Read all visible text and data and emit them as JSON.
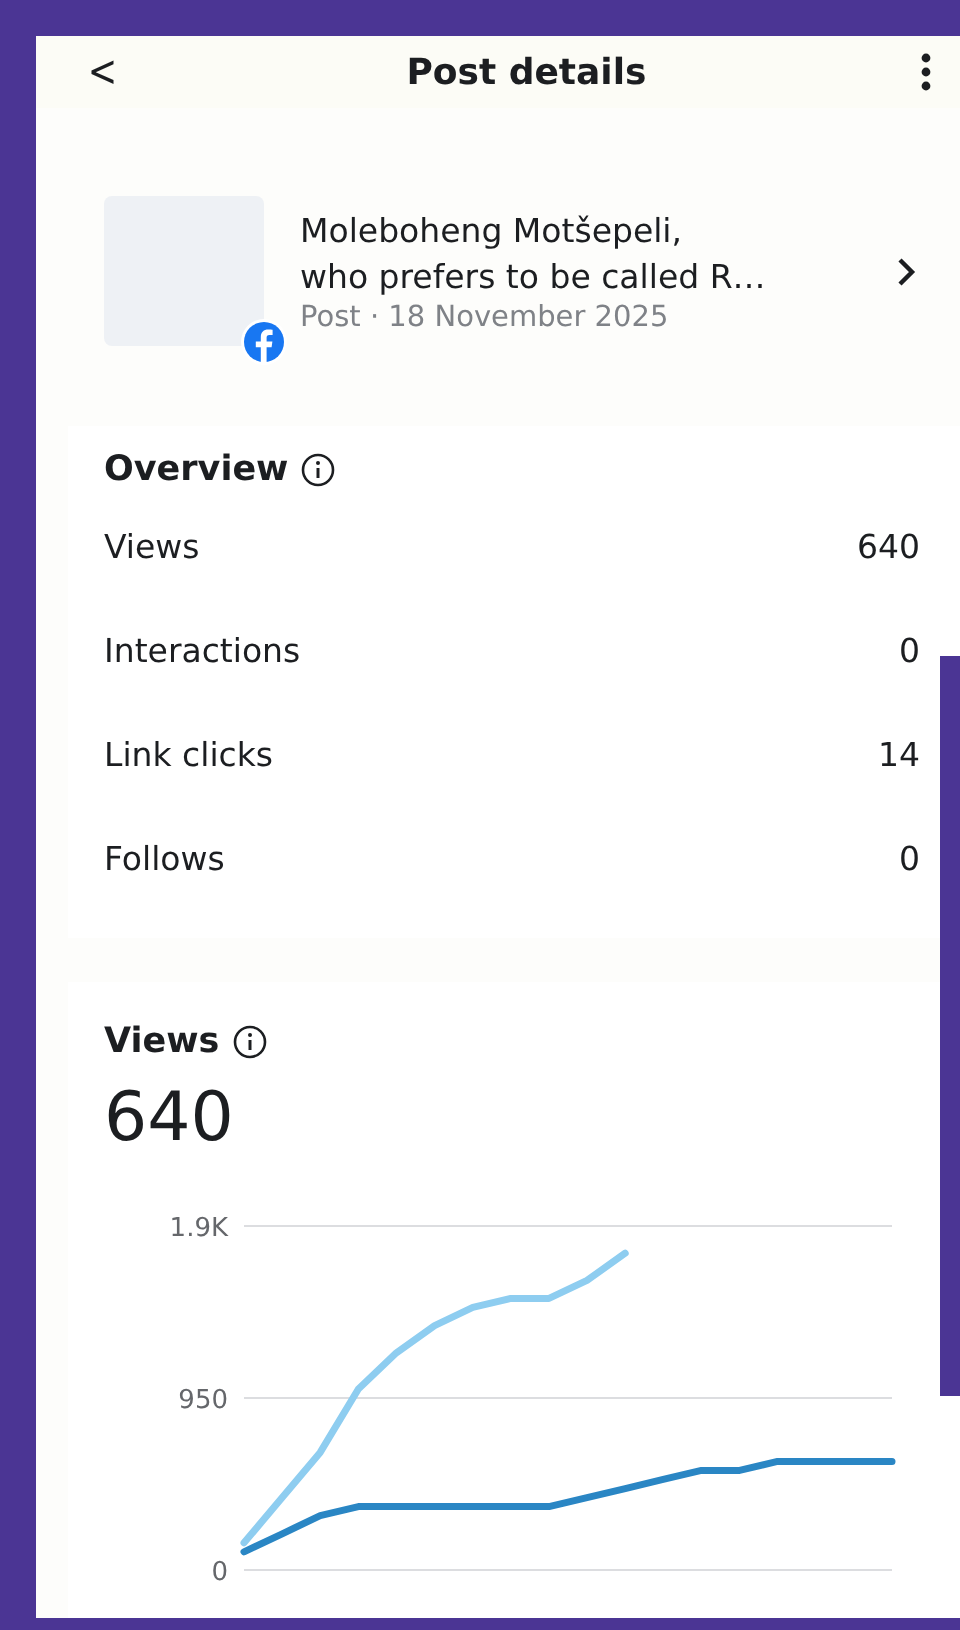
{
  "header": {
    "back": "<",
    "title": "Post details"
  },
  "post": {
    "title": "Moleboheng Motšepeli,\nwho prefers to be called R…",
    "meta": "Post · 18 November 2025"
  },
  "overview": {
    "title": "Overview",
    "rows": [
      {
        "label": "Views",
        "value": "640"
      },
      {
        "label": "Interactions",
        "value": "0"
      },
      {
        "label": "Link clicks",
        "value": "14"
      },
      {
        "label": "Follows",
        "value": "0"
      }
    ]
  },
  "views": {
    "title": "Views",
    "total": "640",
    "chart_data": {
      "type": "line",
      "ylim": [
        0,
        1900
      ],
      "yticks": [
        0,
        950,
        {
          "value": 1900,
          "label": "1.9K"
        }
      ],
      "series": [
        {
          "color": "#8ecdf0",
          "values": [
            150,
            400,
            650,
            1000,
            1200,
            1350,
            1450,
            1500,
            1500,
            1600,
            1750,
            null,
            null,
            null,
            null,
            null,
            null,
            null
          ]
        },
        {
          "color": "#2a86c4",
          "values": [
            100,
            200,
            300,
            350,
            350,
            350,
            350,
            350,
            350,
            400,
            450,
            500,
            550,
            550,
            600,
            600,
            600,
            600
          ]
        }
      ]
    }
  }
}
